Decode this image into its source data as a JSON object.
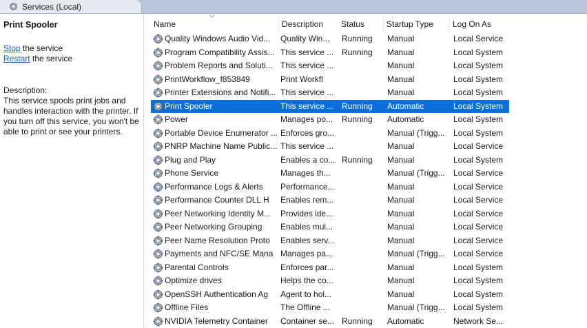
{
  "window": {
    "tab_title": "Services (Local)"
  },
  "left_pane": {
    "title": "Print Spooler",
    "actions": [
      {
        "link": "Stop",
        "rest": " the service"
      },
      {
        "link": "Restart",
        "rest": " the service"
      }
    ],
    "description_heading": "Description:",
    "description": "This service spools print jobs and handles interaction with the printer. If you turn off this service, you won't be able to print or see your printers."
  },
  "columns": [
    "Name",
    "Description",
    "Status",
    "Startup Type",
    "Log On As"
  ],
  "colors": {
    "selection": "#0a6fd8",
    "link": "#1a5fc7"
  },
  "icon": "service-gear-icon",
  "rows": [
    {
      "name": "Quality Windows Audio Vid...",
      "description": "Quality Win...",
      "status": "Running",
      "startup": "Manual",
      "logon": "Local Service"
    },
    {
      "name": "Program Compatibility Assis...",
      "description": "This service ...",
      "status": "Running",
      "startup": "Manual",
      "logon": "Local System"
    },
    {
      "name": "Problem Reports and Soluti...",
      "description": "This service ...",
      "status": "",
      "startup": "Manual",
      "logon": "Local System"
    },
    {
      "name": "PrintWorkflow_f853849",
      "description": "Print Workfl",
      "status": "",
      "startup": "Manual",
      "logon": "Local System"
    },
    {
      "name": "Printer Extensions and Notifi...",
      "description": "This service ...",
      "status": "",
      "startup": "Manual",
      "logon": "Local System"
    },
    {
      "name": "Print Spooler",
      "description": "This service ...",
      "status": "Running",
      "startup": "Automatic",
      "logon": "Local System",
      "selected": true
    },
    {
      "name": "Power",
      "description": "Manages po...",
      "status": "Running",
      "startup": "Automatic",
      "logon": "Local System"
    },
    {
      "name": "Portable Device Enumerator ...",
      "description": "Enforces gro...",
      "status": "",
      "startup": "Manual (Trigg...",
      "logon": "Local System"
    },
    {
      "name": "PNRP Machine Name Public...",
      "description": "This service ...",
      "status": "",
      "startup": "Manual",
      "logon": "Local Service"
    },
    {
      "name": "Plug and Play",
      "description": "Enables a co...",
      "status": "Running",
      "startup": "Manual",
      "logon": "Local System"
    },
    {
      "name": "Phone Service",
      "description": "Manages th...",
      "status": "",
      "startup": "Manual (Trigg...",
      "logon": "Local Service"
    },
    {
      "name": "Performance Logs & Alerts",
      "description": "Performance...",
      "status": "",
      "startup": "Manual",
      "logon": "Local Service"
    },
    {
      "name": "Performance Counter DLL H",
      "description": "Enables rem...",
      "status": "",
      "startup": "Manual",
      "logon": "Local Service"
    },
    {
      "name": "Peer Networking Identity M...",
      "description": "Provides ide...",
      "status": "",
      "startup": "Manual",
      "logon": "Local Service"
    },
    {
      "name": "Peer Networking Grouping",
      "description": "Enables mul...",
      "status": "",
      "startup": "Manual",
      "logon": "Local Service"
    },
    {
      "name": "Peer Name Resolution Proto",
      "description": "Enables serv...",
      "status": "",
      "startup": "Manual",
      "logon": "Local Service"
    },
    {
      "name": "Payments and NFC/SE Mana",
      "description": "Manages pa...",
      "status": "",
      "startup": "Manual (Trigg...",
      "logon": "Local Service"
    },
    {
      "name": "Parental Controls",
      "description": "Enforces par...",
      "status": "",
      "startup": "Manual",
      "logon": "Local System"
    },
    {
      "name": "Optimize drives",
      "description": "Helps the co...",
      "status": "",
      "startup": "Manual",
      "logon": "Local System"
    },
    {
      "name": "OpenSSH Authentication Ag",
      "description": "Agent to hol...",
      "status": "",
      "startup": "Manual",
      "logon": "Local System"
    },
    {
      "name": "Offline Files",
      "description": "The Offline ...",
      "status": "",
      "startup": "Manual (Trigg...",
      "logon": "Local System"
    },
    {
      "name": "NVIDIA Telemetry Container",
      "description": "Container se...",
      "status": "Running",
      "startup": "Automatic",
      "logon": "Network Se..."
    }
  ]
}
